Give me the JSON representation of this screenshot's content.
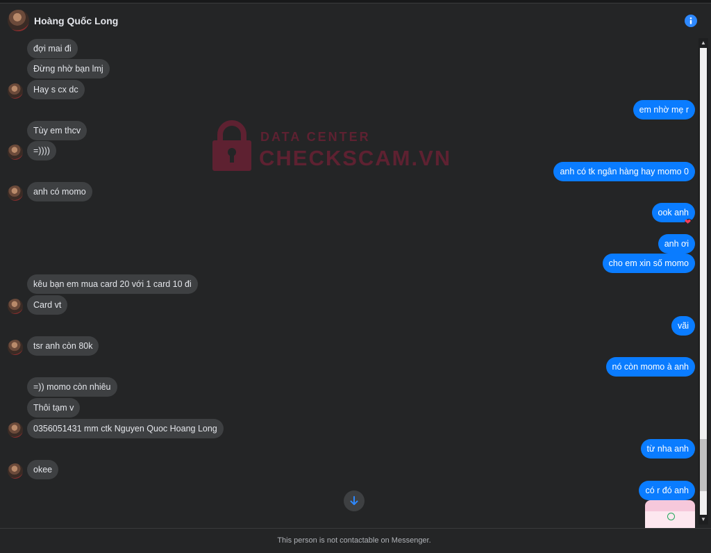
{
  "header": {
    "name": "Hoàng Quốc Long"
  },
  "watermark": {
    "line1": "DATA CENTER",
    "line2": "CHECKSCAM.VN"
  },
  "messages": [
    {
      "dir": "in",
      "text": "đợi mai đi"
    },
    {
      "dir": "in",
      "text": "Đừng nhờ bạn lmj"
    },
    {
      "dir": "in",
      "text": "Hay s cx dc"
    },
    {
      "dir": "out",
      "text": "em nhờ mẹ r"
    },
    {
      "dir": "in",
      "text": "Tùy em thcv"
    },
    {
      "dir": "in",
      "text": "=))))"
    },
    {
      "dir": "out",
      "text": "anh có tk ngân hàng hay momo 0"
    },
    {
      "dir": "in",
      "text": "anh có momo"
    },
    {
      "dir": "out",
      "text": "ook anh",
      "reaction": "❤"
    },
    {
      "dir": "out",
      "text": "anh ơi"
    },
    {
      "dir": "out",
      "text": "cho em xin số momo"
    },
    {
      "dir": "in",
      "text": "kêu bạn em mua card 20 với 1 card 10 đi"
    },
    {
      "dir": "in",
      "text": "Card vt"
    },
    {
      "dir": "out",
      "text": "vãi"
    },
    {
      "dir": "in",
      "text": "tsr anh còn 80k"
    },
    {
      "dir": "out",
      "text": "nó còn momo à anh"
    },
    {
      "dir": "in",
      "text": "=)) momo còn nhiêu"
    },
    {
      "dir": "in",
      "text": "Thôi tạm v"
    },
    {
      "dir": "in",
      "text": "0356051431 mm ctk Nguyen Quoc Hoang Long"
    },
    {
      "dir": "out",
      "text": "từ nha anh"
    },
    {
      "dir": "in",
      "text": "okee"
    },
    {
      "dir": "out",
      "text": "có r đó anh"
    }
  ],
  "footer": {
    "text": "This person is not contactable on Messenger."
  },
  "colors": {
    "background": "#242526",
    "incoming": "#3e4042",
    "outgoing": "#0a7cff",
    "accent": "#2e89ff"
  },
  "icons": {
    "info": "info-icon",
    "scroll_down": "arrow-down-icon",
    "reaction": "heart-icon"
  }
}
